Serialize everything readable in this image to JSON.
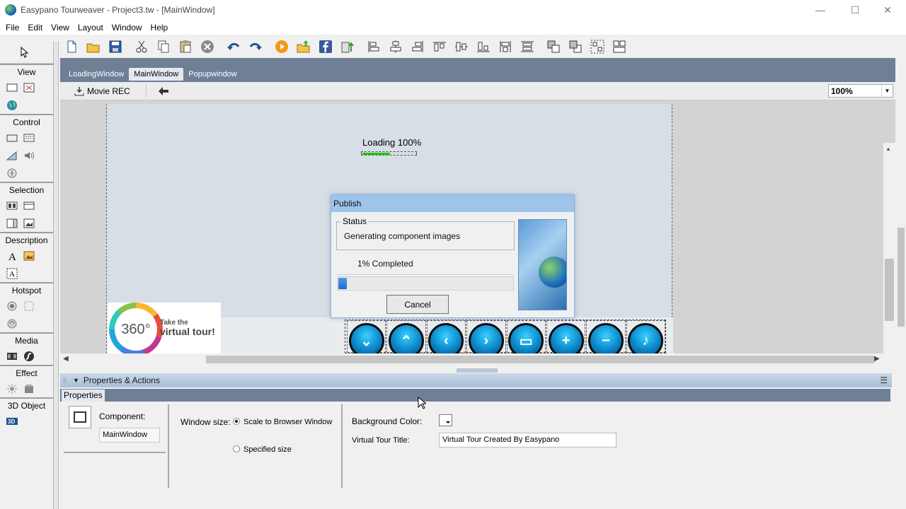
{
  "window": {
    "title": "Easypano Tourweaver - Project3.tw - [MainWindow]",
    "controls": {
      "minimize": "—",
      "maximize": "☐",
      "close": "✕"
    }
  },
  "menu": [
    "File",
    "Edit",
    "View",
    "Layout",
    "Window",
    "Help"
  ],
  "toolbar": {
    "icons": [
      "new-icon",
      "open-icon",
      "save-icon",
      "cut-icon",
      "copy-icon",
      "paste-icon",
      "delete-icon",
      "undo-icon",
      "redo-icon",
      "preview-icon",
      "publish-icon",
      "facebook-icon",
      "export-icon",
      "align-left-icon",
      "align-center-icon",
      "align-right-icon",
      "align-top-icon",
      "align-middle-icon",
      "align-bottom-icon",
      "same-width-icon",
      "same-height-icon",
      "bring-forward-icon",
      "send-backward-icon",
      "group-icon",
      "ungroup-icon"
    ]
  },
  "palette": {
    "sections": [
      {
        "title": "View"
      },
      {
        "title": "Control"
      },
      {
        "title": "Selection"
      },
      {
        "title": "Description"
      },
      {
        "title": "Hotspot"
      },
      {
        "title": "Media"
      },
      {
        "title": "Effect"
      },
      {
        "title": "3D Object"
      }
    ]
  },
  "doc_tabs": [
    {
      "label": "LoadingWindow",
      "active": false
    },
    {
      "label": "MainWindow",
      "active": true
    },
    {
      "label": "Popupwindow",
      "active": false
    }
  ],
  "subbar": {
    "movie_rec": "Movie REC",
    "zoom": "100%"
  },
  "canvas": {
    "loading_text": "Loading 100%",
    "loading_progress": 0.5,
    "badge": {
      "number": "360°",
      "line1": "Take the",
      "line2": "virtual tour!"
    },
    "nav_buttons": [
      "down",
      "up",
      "left",
      "right",
      "fullscreen",
      "zoom-in",
      "zoom-out",
      "sound"
    ]
  },
  "dialog": {
    "title": "Publish",
    "status_legend": "Status",
    "status_text": "Generating component images",
    "percent_text": "1%  Completed",
    "progress": 0.05,
    "cancel": "Cancel"
  },
  "properties": {
    "panel_title": "Properties & Actions",
    "tab": "Properties",
    "component_label": "Component:",
    "component_value": "MainWindow",
    "window_size_label": "Window size:",
    "radio_scale": "Scale to Browser Window",
    "radio_specified": "Specified size",
    "bg_color_label": "Background Color:",
    "vt_title_label": "Virtual Tour Title:",
    "vt_title_value": "Virtual Tour Created By Easypano"
  }
}
